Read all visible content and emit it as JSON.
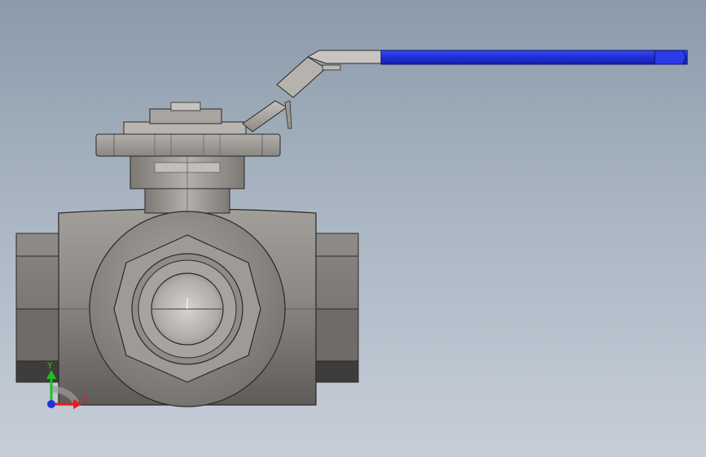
{
  "scene": {
    "model": "three-way-ball-valve",
    "background_top": "#8c9aaa",
    "background_bottom": "#c6ced8",
    "handle_color": "#1f2ed6",
    "body_color": "#8f8b87"
  },
  "triad": {
    "y_label": "Y",
    "x_label": "X",
    "y_color": "#20c020",
    "x_color": "#e02020",
    "z_color": "#2030e0"
  }
}
